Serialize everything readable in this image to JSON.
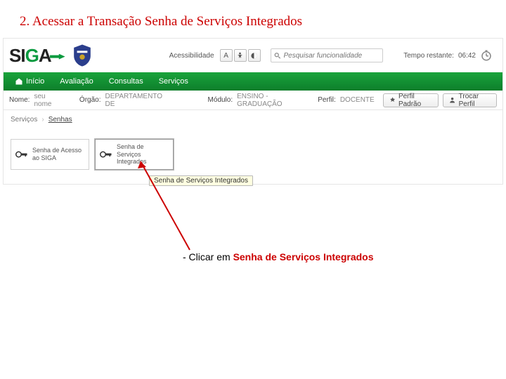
{
  "heading": "2. Acessar a Transação Senha de Serviços Integrados",
  "top": {
    "accessibility_label": "Acessibilidade",
    "search_placeholder": "Pesquisar funcionalidade",
    "timer_label": "Tempo restante:",
    "timer_value": "06:42"
  },
  "menu": {
    "home": "Início",
    "avaliacao": "Avaliação",
    "consultas": "Consultas",
    "servicos": "Serviços"
  },
  "info": {
    "nome_label": "Nome:",
    "nome_value": "seu nome",
    "orgao_label": "Órgão:",
    "orgao_value": "DEPARTAMENTO DE",
    "modulo_label": "Módulo:",
    "modulo_value": "ENSINO - GRADUAÇÃO",
    "perfil_label": "Perfil:",
    "perfil_value": "DOCENTE",
    "perfil_padrao_btn": "Perfil Padrão",
    "trocar_perfil_btn": "Trocar Perfil"
  },
  "crumbs": {
    "root": "Serviços",
    "current": "Senhas"
  },
  "tiles": {
    "siga": "Senha de Acesso ao SIGA",
    "integrados": "Senha de Serviços Integrados"
  },
  "tooltip": "Senha de Serviços Integrados",
  "instruction": {
    "prefix": "- Clicar em ",
    "target": "Senha de Serviços Integrados"
  }
}
